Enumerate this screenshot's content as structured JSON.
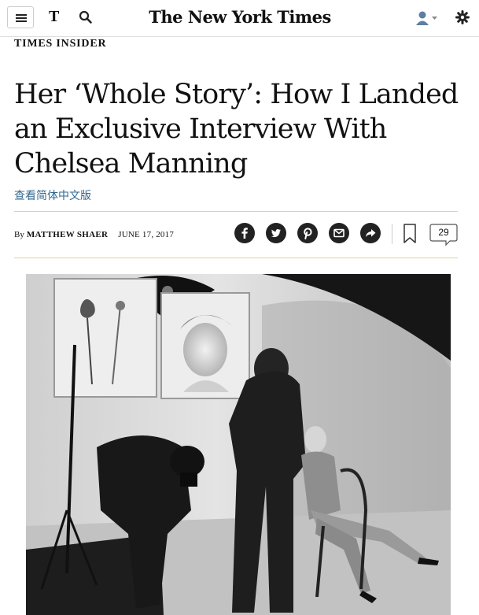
{
  "header": {
    "masthead": "The New York Times",
    "t_logo": "T",
    "icons": [
      "menu-icon",
      "t-logo-icon",
      "search-icon",
      "user-icon",
      "gear-icon"
    ]
  },
  "article": {
    "kicker": "TIMES INSIDER",
    "headline": "Her ‘Whole Story’: How I Landed an Exclusive Interview With Chelsea Manning",
    "translation_link": "查看简体中文版",
    "byline_prefix": "By",
    "author": "MATTHEW SHAER",
    "date": "JUNE 17, 2017",
    "comment_count": "29"
  },
  "share": [
    "facebook-icon",
    "twitter-icon",
    "pinterest-icon",
    "email-icon",
    "share-icon"
  ],
  "colors": {
    "accent_rule": "#e6d48a",
    "link": "#326891"
  }
}
